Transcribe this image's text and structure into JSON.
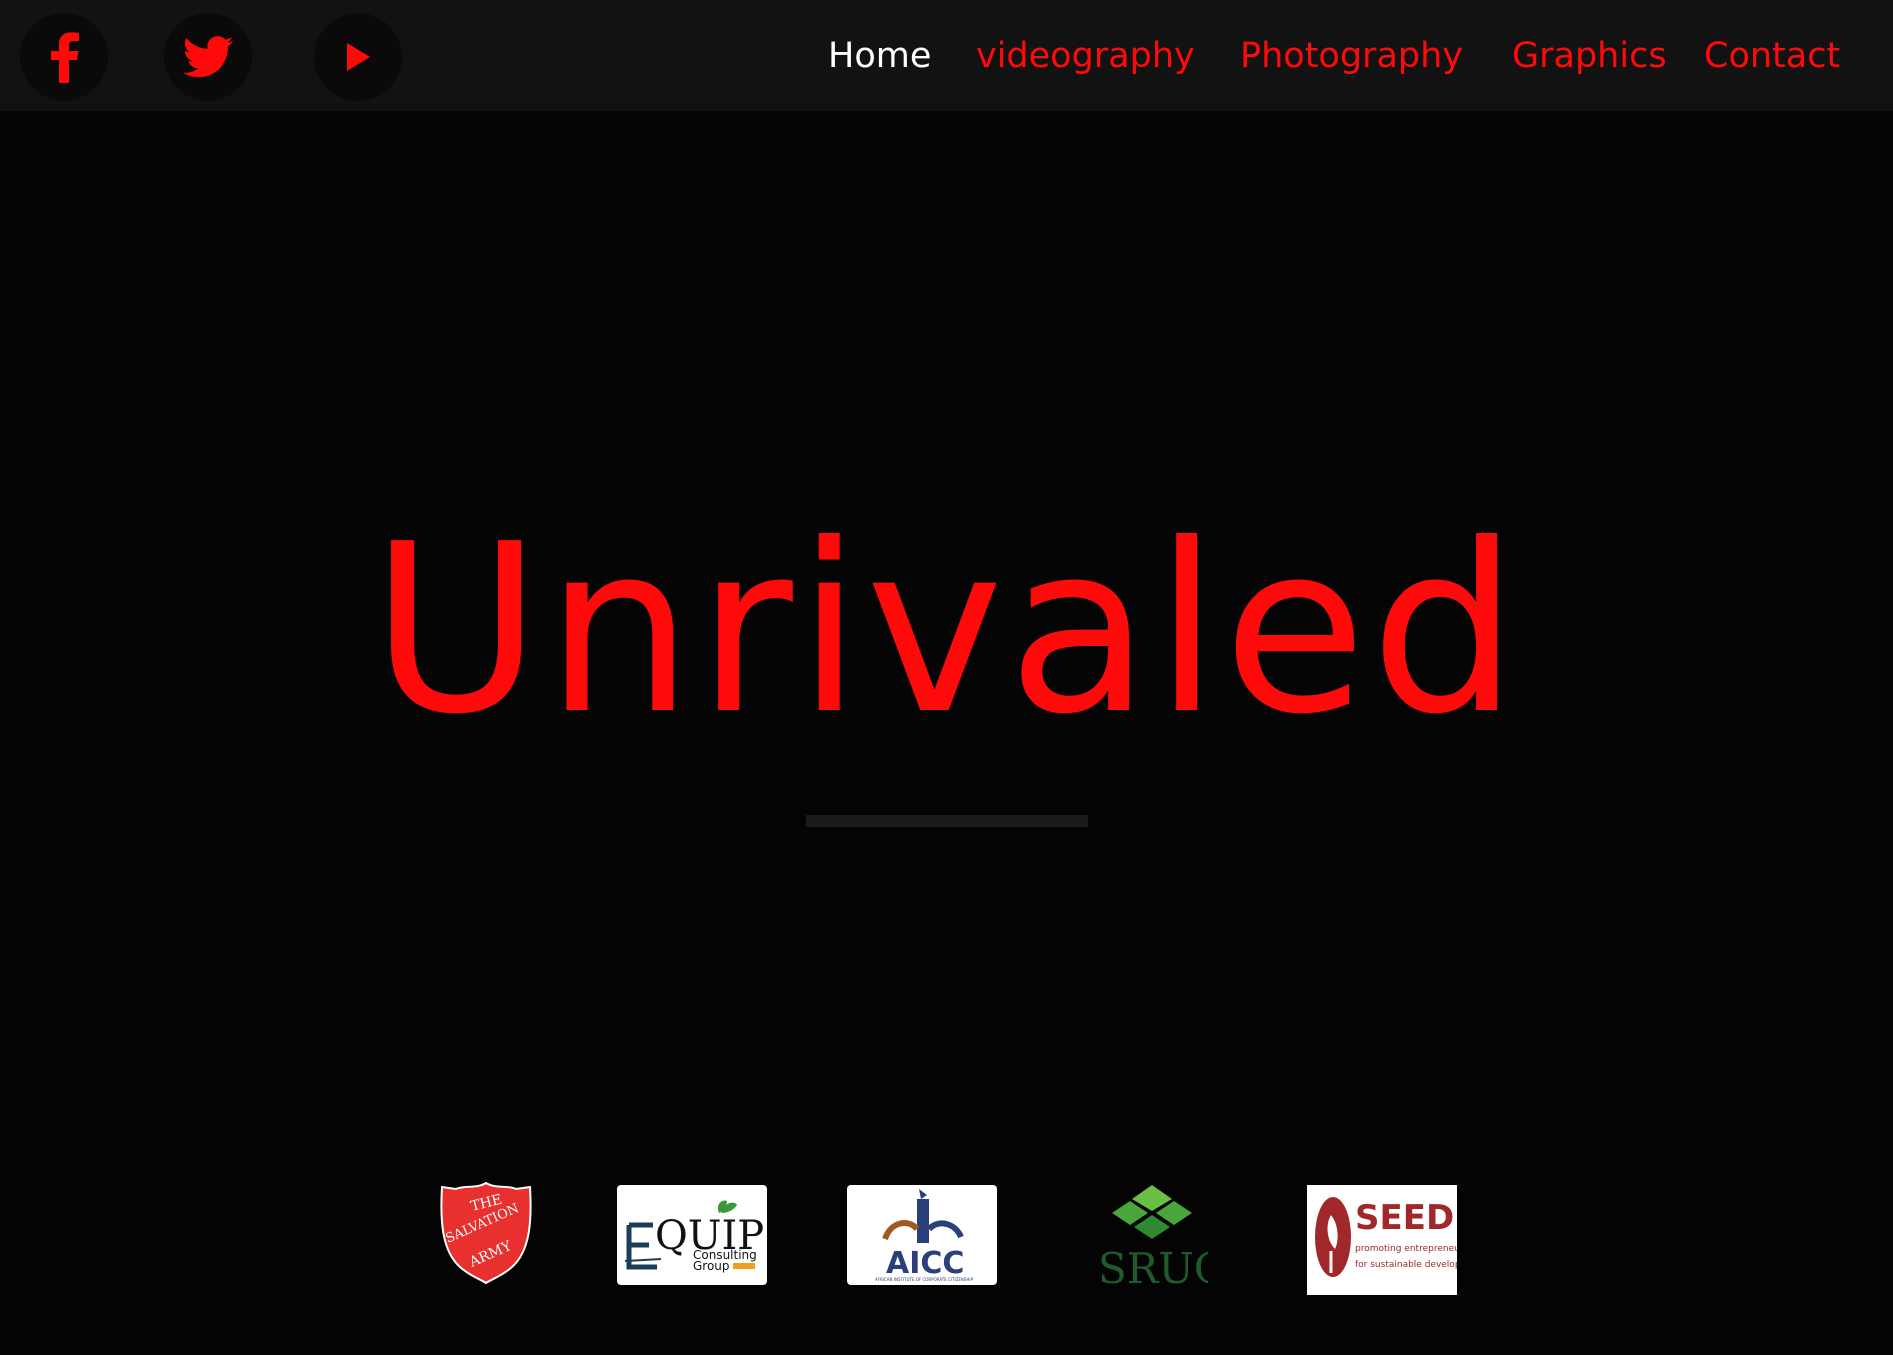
{
  "colors": {
    "accent": "#ff0a0a",
    "nav_active": "#ffffff",
    "background": "#040404",
    "topbar": "#121212"
  },
  "social": [
    {
      "icon": "facebook-icon"
    },
    {
      "icon": "twitter-icon"
    },
    {
      "icon": "youtube-play-icon"
    }
  ],
  "nav": {
    "items": [
      {
        "label": "Home",
        "active": true
      },
      {
        "label": "videography",
        "active": false
      },
      {
        "label": "Photography",
        "active": false
      },
      {
        "label": "Graphics",
        "active": false
      },
      {
        "label": "Contact",
        "active": false
      }
    ]
  },
  "hero": {
    "title": "Unrivaled"
  },
  "partners": [
    {
      "name": "salvation-army-logo",
      "text_lines": [
        "THE",
        "SALVATION",
        "ARMY"
      ]
    },
    {
      "name": "equip-logo",
      "text_main": "QUIP",
      "text_sub1": "Consulting",
      "text_sub2": "Group"
    },
    {
      "name": "aicc-logo",
      "text_main": "AICC",
      "text_sub": "AFRICAN INSTITUTE OF CORPORATE CITIZENSHIP"
    },
    {
      "name": "sruc-logo",
      "text_main": "SRUC"
    },
    {
      "name": "seed-logo",
      "text_main": "SEED",
      "text_sub1": "promoting entrepreneurship",
      "text_sub2": "for sustainable development"
    }
  ]
}
